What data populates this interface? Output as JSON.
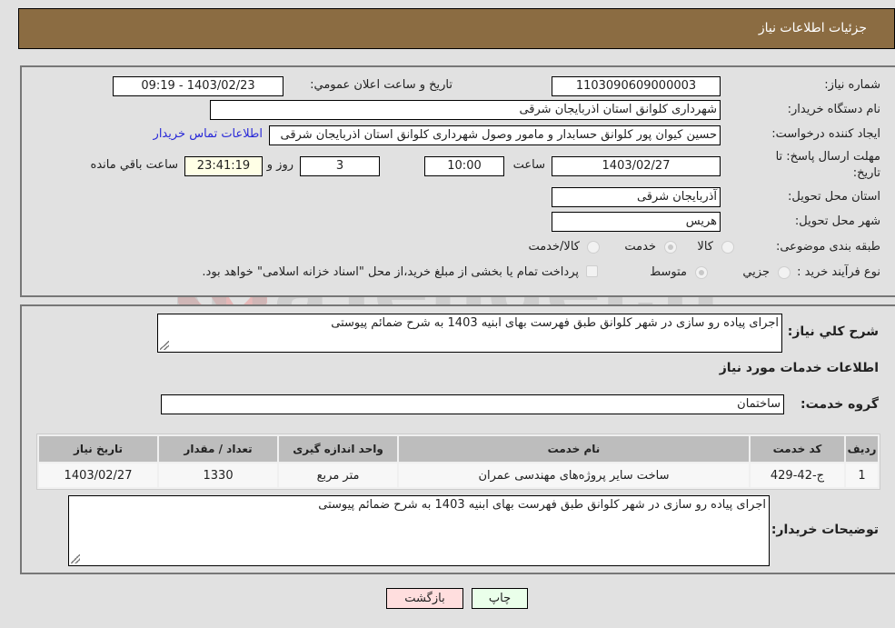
{
  "header": {
    "title": "جزئیات اطلاعات نیاز"
  },
  "form": {
    "need_number": {
      "label": "شماره نیاز:",
      "value": "1103090609000003"
    },
    "announce": {
      "label": "تاریخ و ساعت اعلان عمومي:",
      "value": "1403/02/23 - 09:19"
    },
    "buyer_org": {
      "label": "نام دستگاه خريدار:",
      "value": "شهرداری کلوانق استان اذربایجان شرقی"
    },
    "requester": {
      "label": "ایجاد کننده درخواست:",
      "value": "حسین  کیوان پور کلوانق حسابدار و مامور وصول شهرداری کلوانق استان اذربایجان شرقی",
      "contact_link": "اطلاعات تماس خریدار"
    },
    "deadline": {
      "label_line1": "مهلت ارسال پاسخ: تا",
      "label_line2": "تاريخ:",
      "date": "1403/02/27",
      "time_label": "ساعت",
      "time": "10:00",
      "days": "3",
      "days_label": "روز و",
      "remaining": "23:41:19",
      "remaining_label": "ساعت باقي مانده"
    },
    "province": {
      "label": "استان محل تحویل:",
      "value": "آذربایجان شرقی"
    },
    "city": {
      "label": "شهر محل تحویل:",
      "value": "هريس"
    },
    "category": {
      "label": "طبقه بندی موضوعی:",
      "options": [
        "کالا",
        "خدمت",
        "کالا/خدمت"
      ],
      "selected": "خدمت"
    },
    "process": {
      "label": "نوع فرآیند خرید :",
      "options": [
        "جزيي",
        "متوسط"
      ],
      "selected": "متوسط",
      "treasury_note": "پرداخت تمام یا بخشی از مبلغ خرید،از محل \"اسناد خزانه اسلامی\" خواهد بود."
    }
  },
  "details": {
    "summary_label": "شرح کلي نياز:",
    "summary": "اجرای پیاده رو سازی در شهر کلوانق طبق فهرست بهای ابنیه 1403 به شرح ضمائم پیوستی",
    "services_heading": "اطلاعات خدمات مورد نياز",
    "service_group_label": "گروه خدمت:",
    "service_group": "ساختمان",
    "table": {
      "headers": [
        "رديف",
        "کد خدمت",
        "نام خدمت",
        "واحد اندازه گيری",
        "تعداد / مقدار",
        "تاريخ نياز"
      ],
      "rows": [
        [
          "1",
          "ج-42-429",
          "ساخت سایر پروژه‌های مهندسی عمران",
          "متر مربع",
          "1330",
          "1403/02/27"
        ]
      ]
    },
    "buyer_notes_label": "توضیحات خریدار:",
    "buyer_notes": "اجرای پیاده رو سازی در شهر کلوانق طبق فهرست بهای ابنیه 1403 به شرح ضمائم پیوستی"
  },
  "buttons": {
    "print": "چاپ",
    "back": "بازگشت"
  },
  "colors": {
    "header_bg": "#8b6c42",
    "print_bg": "#eaffea",
    "back_bg": "#ffdede",
    "remaining_bg": "#ffffe6",
    "link": "#2a2ad8"
  }
}
